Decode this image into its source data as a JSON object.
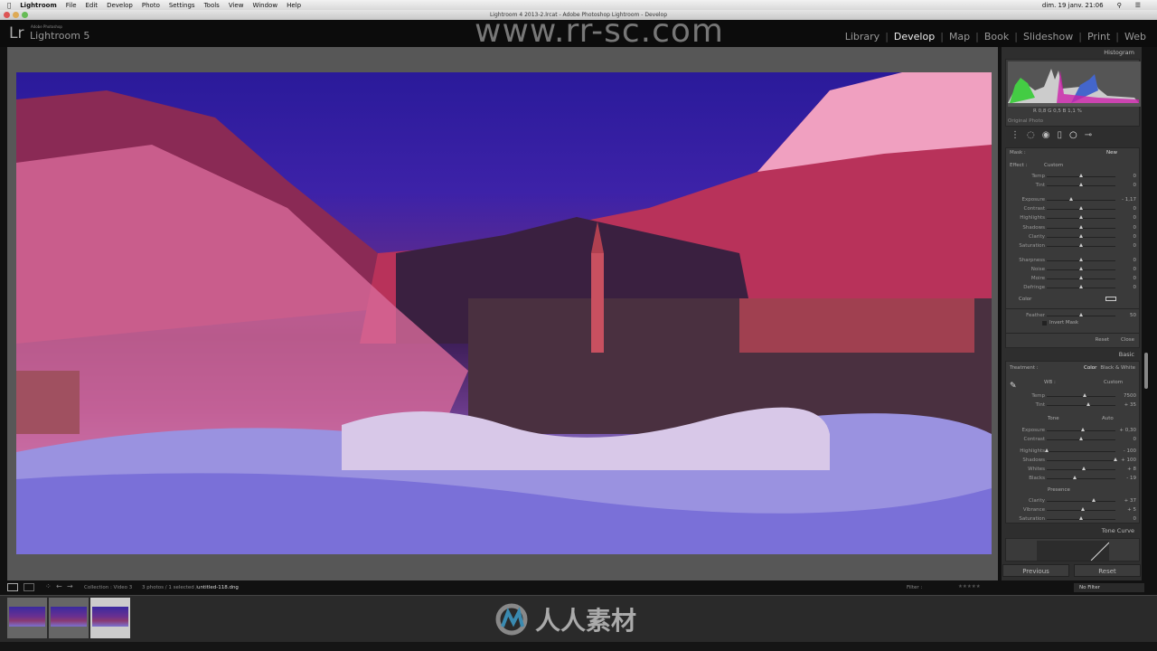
{
  "menubar": {
    "app": "Lightroom",
    "items": [
      "File",
      "Edit",
      "Develop",
      "Photo",
      "Settings",
      "Tools",
      "View",
      "Window",
      "Help"
    ],
    "clock": "dim. 19 janv.  21:06"
  },
  "window_title": "Lightroom 4 2013-2.lrcat - Adobe Photoshop Lightroom - Develop",
  "header": {
    "logo": "Lr",
    "sub": "Adobe Photoshop",
    "name": "Lightroom 5",
    "watermark": "www.rr-sc.com",
    "modules": [
      {
        "label": "Library",
        "active": false
      },
      {
        "label": "Develop",
        "active": true
      },
      {
        "label": "Map"
      },
      {
        "label": "Book"
      },
      {
        "label": "Slideshow"
      },
      {
        "label": "Print"
      },
      {
        "label": "Web"
      }
    ]
  },
  "histogram": {
    "title": "Histogram",
    "readout": "R  0,8  G  0,5  B  1,1 %",
    "original_photo": "Original Photo"
  },
  "mask": {
    "label": "Mask :",
    "new": "New",
    "effect_label": "Effect :",
    "effect_value": "Custom",
    "color_label": "Color",
    "reset": "Reset",
    "close": "Close",
    "invert": "Invert Mask",
    "sliders": [
      {
        "label": "Temp",
        "value": "0",
        "level": 0.5
      },
      {
        "label": "Tint",
        "value": "0",
        "level": 0.5
      },
      {
        "label": "Exposure",
        "value": "- 1,17",
        "level": 0.35
      },
      {
        "label": "Contrast",
        "value": "0",
        "level": 0.5
      },
      {
        "label": "Highlights",
        "value": "0",
        "level": 0.5
      },
      {
        "label": "Shadows",
        "value": "0",
        "level": 0.5
      },
      {
        "label": "Clarity",
        "value": "0",
        "level": 0.5
      },
      {
        "label": "Saturation",
        "value": "0",
        "level": 0.5
      },
      {
        "label": "Sharpness",
        "value": "0",
        "level": 0.5
      },
      {
        "label": "Noise",
        "value": "0",
        "level": 0.5
      },
      {
        "label": "Moire",
        "value": "0",
        "level": 0.5
      },
      {
        "label": "Defringe",
        "value": "0",
        "level": 0.5
      }
    ],
    "feather": {
      "label": "Feather",
      "value": "50",
      "level": 0.5
    }
  },
  "basic": {
    "title": "Basic",
    "treatment": "Treatment :",
    "color": "Color",
    "bw": "Black & White",
    "wb": "WB :",
    "wb_value": "Custom",
    "tone": "Tone",
    "auto": "Auto",
    "presence": "Presence",
    "wb_sliders": [
      {
        "label": "Temp",
        "value": "7500",
        "level": 0.55
      },
      {
        "label": "Tint",
        "value": "+ 35",
        "level": 0.6
      }
    ],
    "tone_sliders": [
      {
        "label": "Exposure",
        "value": "+ 0,30",
        "level": 0.53
      },
      {
        "label": "Contrast",
        "value": "0",
        "level": 0.5
      },
      {
        "label": "Highlights",
        "value": "- 100",
        "level": 0.0
      },
      {
        "label": "Shadows",
        "value": "+ 100",
        "level": 1.0
      },
      {
        "label": "Whites",
        "value": "+ 8",
        "level": 0.54
      },
      {
        "label": "Blacks",
        "value": "- 19",
        "level": 0.41
      }
    ],
    "presence_sliders": [
      {
        "label": "Clarity",
        "value": "+ 37",
        "level": 0.68
      },
      {
        "label": "Vibrance",
        "value": "+ 5",
        "level": 0.52
      },
      {
        "label": "Saturation",
        "value": "0",
        "level": 0.5
      }
    ]
  },
  "tone_curve": {
    "title": "Tone Curve"
  },
  "buttons": {
    "previous": "Previous",
    "reset": "Reset"
  },
  "filmstrip": {
    "collection": "Collection : Video 3",
    "info": "3 photos / 1 selected /",
    "file": "untitled-118.dng",
    "filter_label": "Filter :",
    "filter_value": "No Filter",
    "selected_index": 2,
    "count": 3
  },
  "logo_text": "人人素材"
}
